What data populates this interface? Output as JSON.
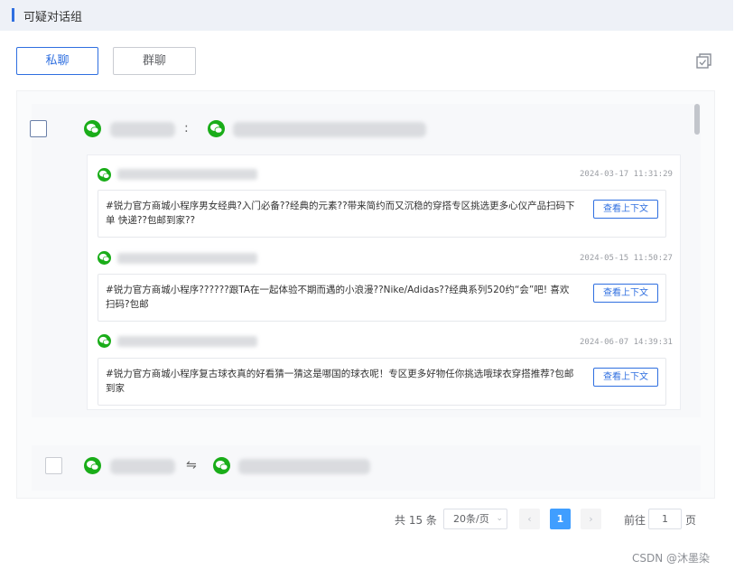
{
  "header": {
    "title": "可疑对话组"
  },
  "tabs": [
    {
      "label": "私聊",
      "active": true
    },
    {
      "label": "群聊",
      "active": false
    }
  ],
  "toolbar": {
    "select_all_icon": "checkbox-stack-icon"
  },
  "groups": [
    {
      "separator": ":",
      "messages": [
        {
          "time": "2024-03-17 11:31:29",
          "text": "#锐力官方商城小程序男女经典?入门必备??经典的元素??带来简约而又沉稳的穿搭专区挑选更多心仪产品扫码下单 快递??包邮到家??",
          "button": "查看上下文"
        },
        {
          "time": "2024-05-15 11:50:27",
          "text": "#锐力官方商城小程序??????跟TA在一起体验不期而遇的小浪漫??Nike/Adidas??经典系列520约“会”吧! 喜欢扫码?包邮",
          "button": "查看上下文"
        },
        {
          "time": "2024-06-07 14:39:31",
          "text": "#锐力官方商城小程序复古球衣真的好看猜一猜这是哪国的球衣呢！专区更多好物任你挑选哦球衣穿搭推荐?包邮到家",
          "button": "查看上下文"
        }
      ]
    },
    {
      "separator": "⇋"
    }
  ],
  "pagination": {
    "total": "共 15 条",
    "page_size": "20条/页",
    "current_page": "1",
    "goto_label": "前往",
    "goto_value": "1",
    "goto_unit": "页"
  },
  "watermark": "CSDN @沐墨染",
  "colors": {
    "accent": "#2f6fe0",
    "wechat": "#1aad19",
    "page_active": "#409eff"
  }
}
